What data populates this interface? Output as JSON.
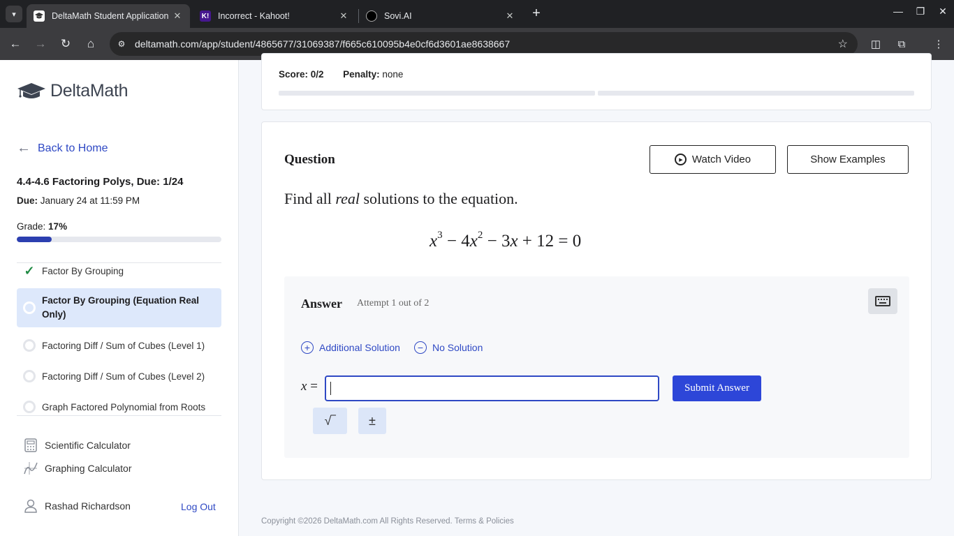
{
  "browser": {
    "tabs": [
      {
        "title": "DeltaMath Student Application",
        "favicon": "deltamath-cap-icon",
        "active": true
      },
      {
        "title": "Incorrect - Kahoot!",
        "favicon": "kahoot-icon",
        "favicon_text": "K!",
        "active": false
      },
      {
        "title": "Sovi.AI",
        "favicon": "sovi-icon",
        "active": false
      }
    ],
    "url": "deltamath.com/app/student/4865677/31069387/f665c610095b4e0cf6d3601ae8638667",
    "new_tab": "+"
  },
  "sidebar": {
    "logo_text": "DeltaMath",
    "back_home": "Back to Home",
    "assignment_title": "4.4-4.6 Factoring Polys, Due: 1/24",
    "due_label": "Due:",
    "due_value": "January 24 at 11:59 PM",
    "grade_label": "Grade:",
    "grade_value": "17%",
    "grade_fraction": 0.17,
    "skills": [
      {
        "label": "Factor By Grouping",
        "status": "complete"
      },
      {
        "label": "Factor By Grouping (Equation Real Only)",
        "status": "active"
      },
      {
        "label": "Factoring Diff / Sum of Cubes (Level 1)",
        "status": "not-started"
      },
      {
        "label": "Factoring Diff / Sum of Cubes (Level 2)",
        "status": "not-started"
      },
      {
        "label": "Graph Factored Polynomial from Roots",
        "status": "not-started"
      }
    ],
    "tools": [
      {
        "label": "Scientific Calculator",
        "icon": "calculator-icon"
      },
      {
        "label": "Graphing Calculator",
        "icon": "graph-icon"
      }
    ],
    "user_name": "Rashad Richardson",
    "logout": "Log Out"
  },
  "score": {
    "score_label": "Score:",
    "score_value": "0/2",
    "penalty_label": "Penalty:",
    "penalty_value": "none",
    "segments": 2
  },
  "question": {
    "label": "Question",
    "watch_video": "Watch Video",
    "show_examples": "Show Examples",
    "prompt_before": "Find all",
    "prompt_emph": "real",
    "prompt_after": "solutions to the equation.",
    "equation": {
      "t1": "x",
      "e1": "3",
      "op1": "−",
      "c2": "4",
      "t2": "x",
      "e2": "2",
      "op2": "−",
      "c3": "3",
      "t3": "x",
      "op3": "+",
      "c4": "12",
      "eq": "=",
      "rhs": "0"
    }
  },
  "answer": {
    "label": "Answer",
    "attempt": "Attempt 1 out of 2",
    "additional_solution": "Additional Solution",
    "no_solution": "No Solution",
    "variable": "x",
    "equals": "=",
    "input_value": "",
    "submit": "Submit Answer",
    "sqrt_symbol": "√‾",
    "plusminus_symbol": "±"
  },
  "footer": {
    "copyright": "Copyright ©2026 DeltaMath.com All Rights Reserved.",
    "terms": "Terms & Policies"
  },
  "colors": {
    "accent": "#2f49c4",
    "submit": "#2d46d8",
    "progress": "#2c3fb0",
    "active_skill_bg": "#dde8fb",
    "check": "#1f8a43"
  }
}
